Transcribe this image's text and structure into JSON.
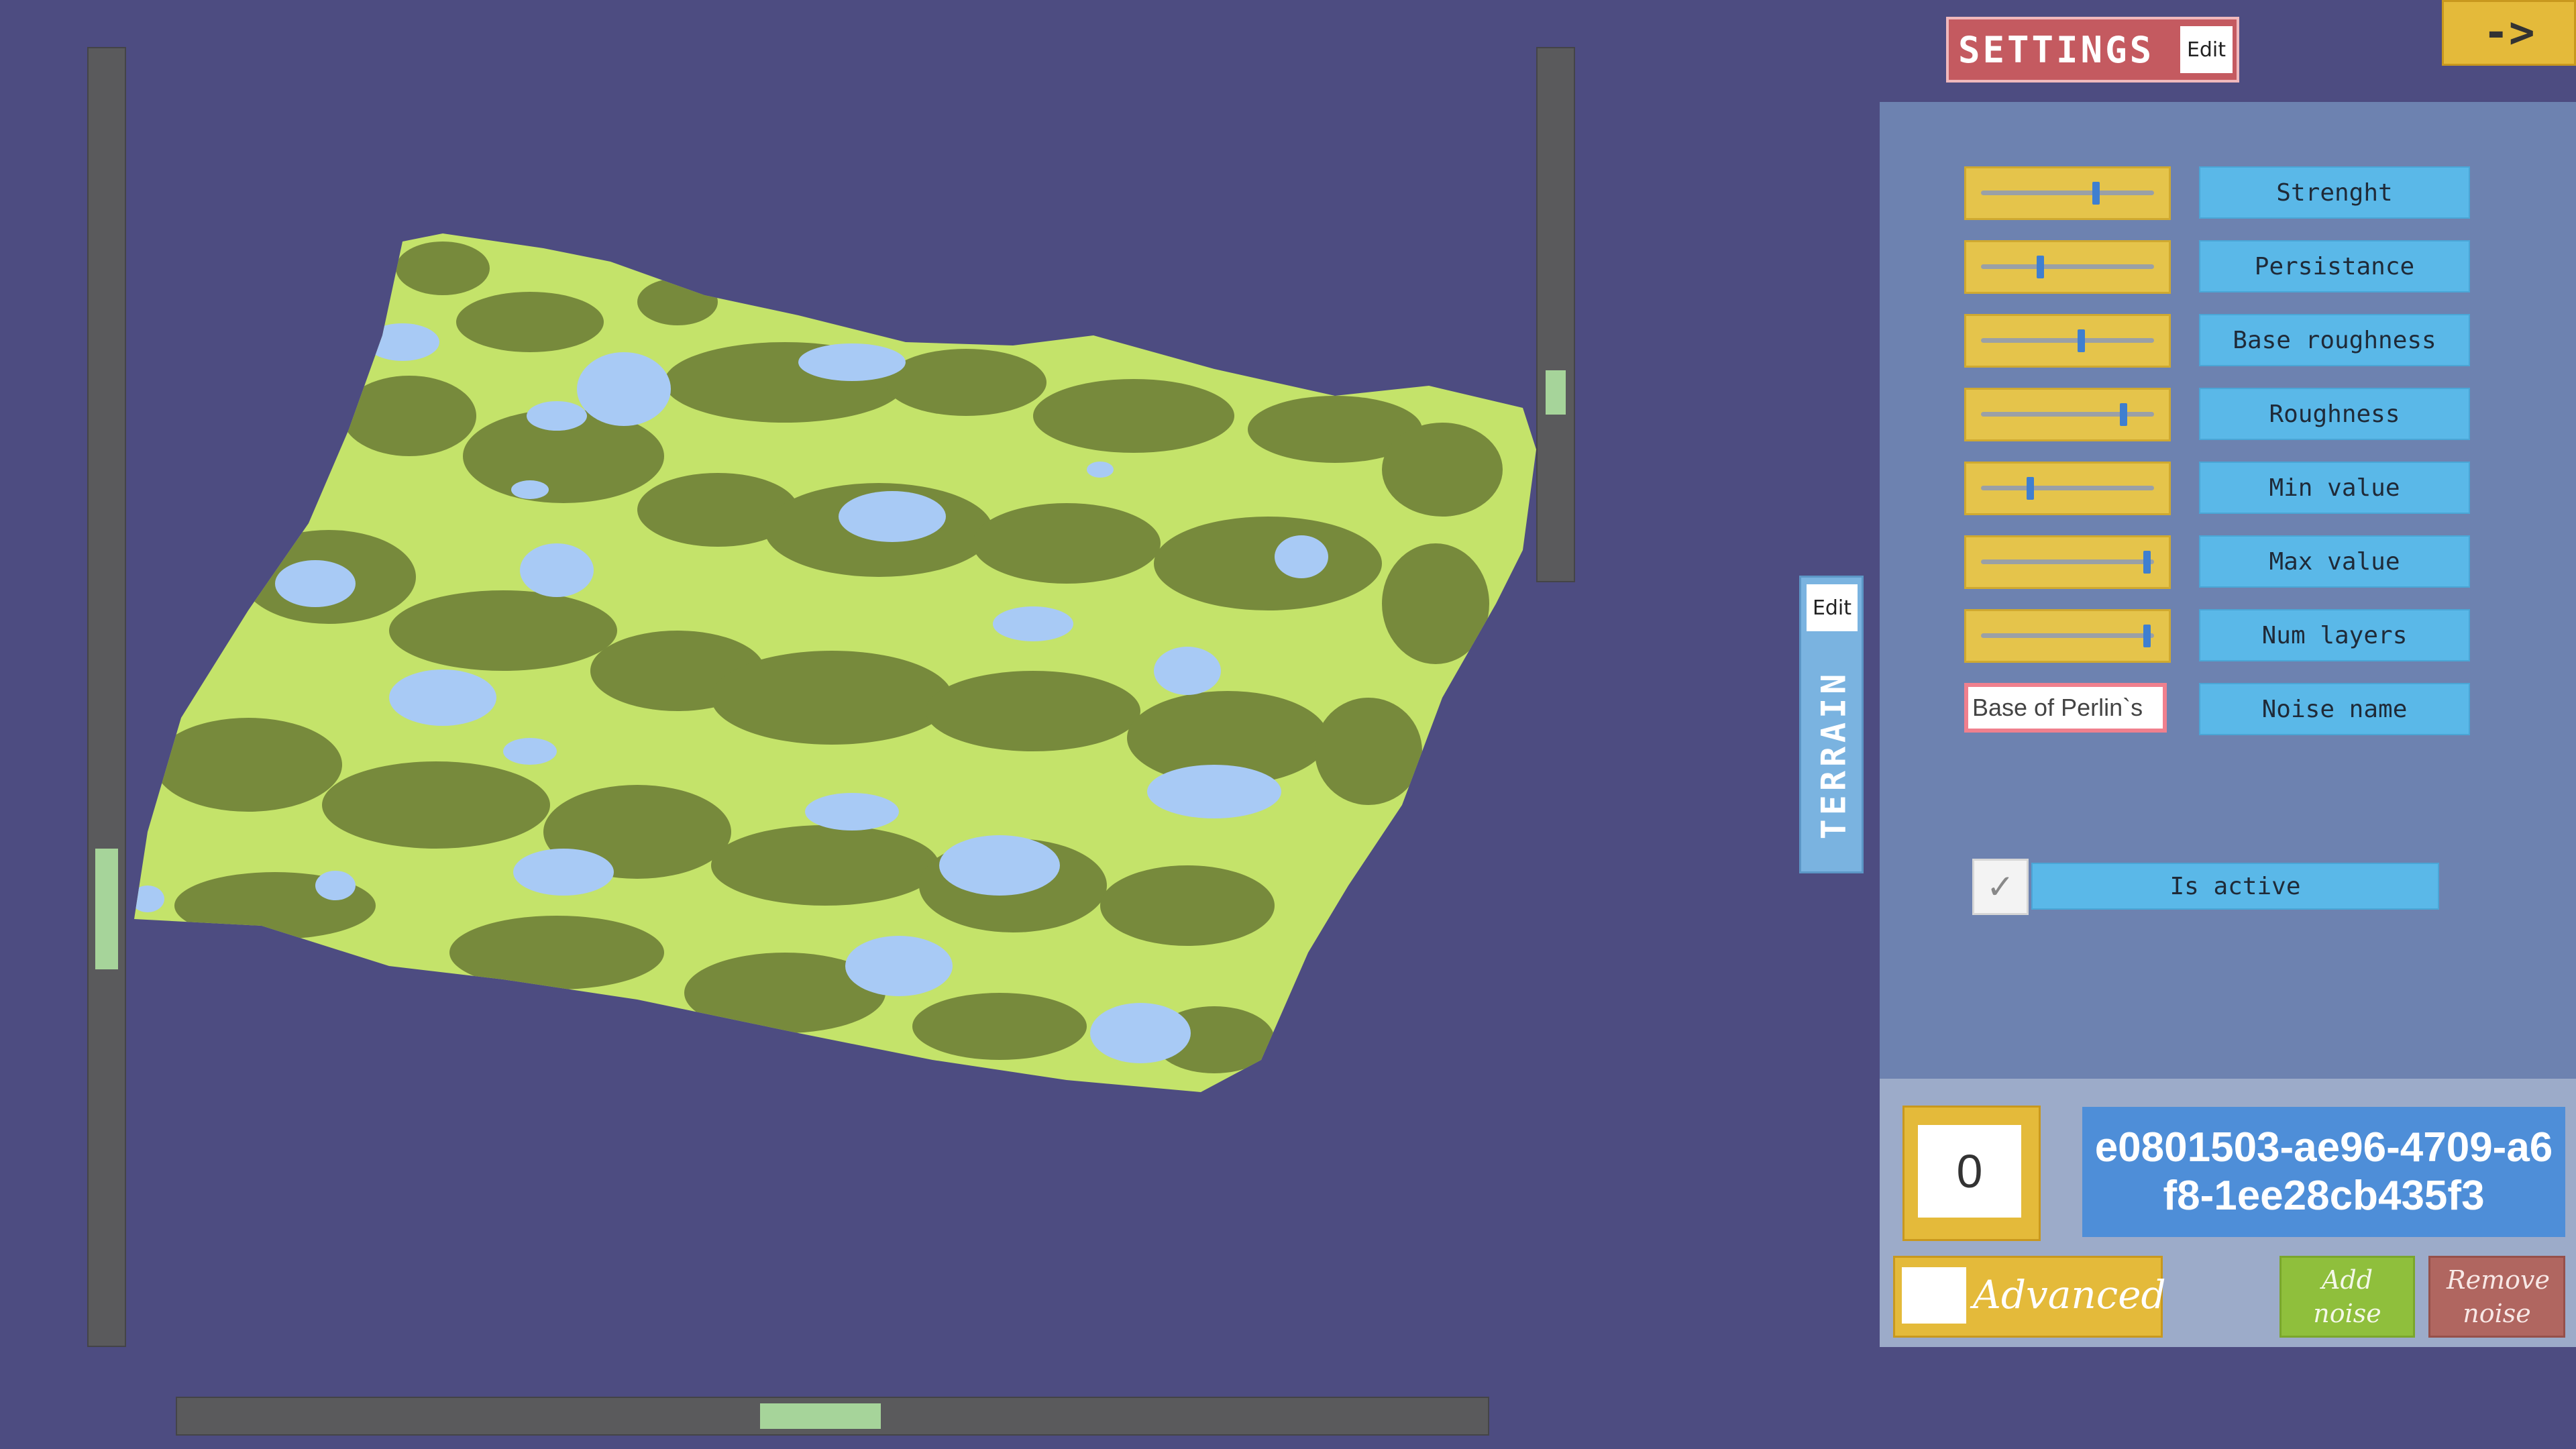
{
  "settings_tab": {
    "title": "SETTINGS",
    "edit_label": "Edit"
  },
  "next_button": {
    "label": "->"
  },
  "terrain_tab": {
    "title": "TERRAIN",
    "edit_label": "Edit"
  },
  "parameters": [
    {
      "label": "Strenght",
      "value": 0.68
    },
    {
      "label": "Persistance",
      "value": 0.35
    },
    {
      "label": "Base roughness",
      "value": 0.59
    },
    {
      "label": "Roughness",
      "value": 0.84
    },
    {
      "label": "Min value",
      "value": 0.29
    },
    {
      "label": "Max value",
      "value": 0.98
    },
    {
      "label": "Num layers",
      "value": 0.98
    }
  ],
  "noise_name": {
    "value": "Base of Perlin`s",
    "label": "Noise name"
  },
  "is_active": {
    "label": "Is active",
    "checked": true,
    "check_glyph": "✓"
  },
  "noise_index": "0",
  "noise_guid": "e0801503-ae96-4709-a6f8-1ee28cb435f3",
  "advanced": {
    "label": "Advanced",
    "checked": false
  },
  "add_noise": {
    "label": "Add noise"
  },
  "remove_noise": {
    "label": "Remove noise"
  },
  "colors": {
    "background": "#4d4c81",
    "terrain_light": "#c4e36a",
    "terrain_dark": "#778a3c",
    "water": "#a8caf5",
    "panel": "#6d82b0",
    "accent_yellow": "#e4ba3a",
    "label_blue": "#5ab8e8"
  },
  "scrollbars": {
    "left_vertical": 0.68,
    "right_vertical": 0.66,
    "bottom_horizontal": 0.49
  }
}
